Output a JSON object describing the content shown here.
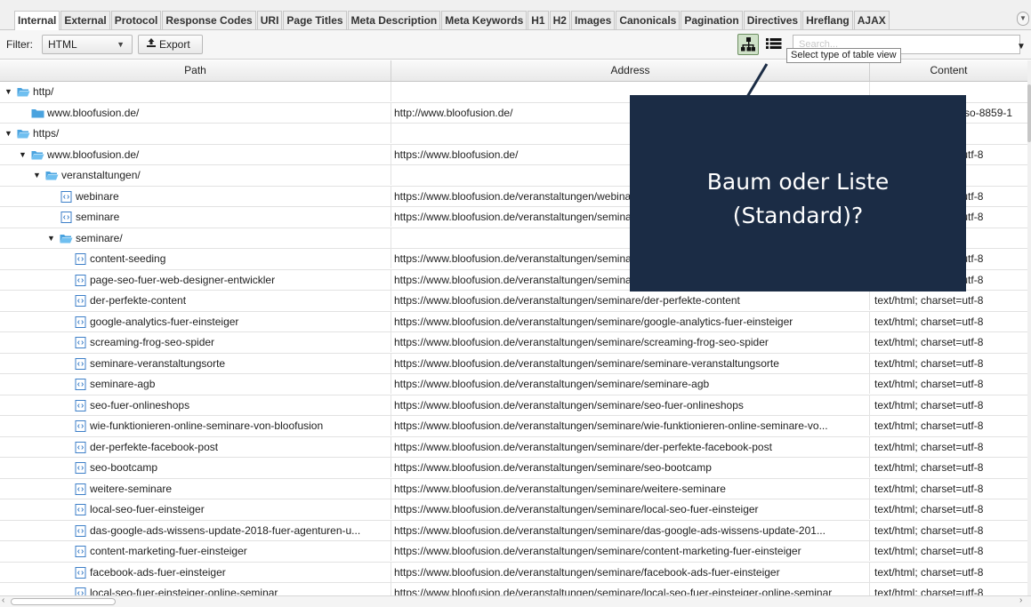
{
  "tabs": [
    "Internal",
    "External",
    "Protocol",
    "Response Codes",
    "URI",
    "Page Titles",
    "Meta Description",
    "Meta Keywords",
    "H1",
    "H2",
    "Images",
    "Canonicals",
    "Pagination",
    "Directives",
    "Hreflang",
    "AJAX"
  ],
  "active_tab": "Internal",
  "toolbar": {
    "filter_label": "Filter:",
    "filter_value": "HTML",
    "export_label": "Export",
    "search_placeholder": "Search...",
    "tooltip": "Select type of table view"
  },
  "columns": {
    "path": "Path",
    "address": "Address",
    "content": "Content"
  },
  "rows": [
    {
      "path": "http/",
      "level": 0,
      "type": "folder-open",
      "arrow": true,
      "address": "",
      "content": ""
    },
    {
      "path": "www.bloofusion.de/",
      "level": 1,
      "type": "folder",
      "arrow": false,
      "address": "http://www.bloofusion.de/",
      "content": "text/html; charset=iso-8859-1"
    },
    {
      "path": "https/",
      "level": 0,
      "type": "folder-open",
      "arrow": true,
      "address": "",
      "content": ""
    },
    {
      "path": "www.bloofusion.de/",
      "level": 1,
      "type": "folder-open",
      "arrow": true,
      "address": "https://www.bloofusion.de/",
      "content": "text/html; charset=utf-8"
    },
    {
      "path": "veranstaltungen/",
      "level": 2,
      "type": "folder-open",
      "arrow": true,
      "address": "",
      "content": ""
    },
    {
      "path": "webinare",
      "level": 3,
      "type": "file",
      "arrow": false,
      "address": "https://www.bloofusion.de/veranstaltungen/webinare",
      "content": "text/html; charset=utf-8"
    },
    {
      "path": "seminare",
      "level": 3,
      "type": "file",
      "arrow": false,
      "address": "https://www.bloofusion.de/veranstaltungen/seminare",
      "content": "text/html; charset=utf-8"
    },
    {
      "path": "seminare/",
      "level": 3,
      "type": "folder-open",
      "arrow": true,
      "address": "",
      "content": ""
    },
    {
      "path": "content-seeding",
      "level": 4,
      "type": "file",
      "arrow": false,
      "address": "https://www.bloofusion.de/veranstaltungen/seminare/content-seeding",
      "content": "text/html; charset=utf-8"
    },
    {
      "path": "page-seo-fuer-web-designer-entwickler",
      "level": 4,
      "type": "file",
      "arrow": false,
      "address": "https://www.bloofusion.de/veranstaltungen/seminare/page-seo-fuer-web-designer-entwickler",
      "content": "text/html; charset=utf-8"
    },
    {
      "path": "der-perfekte-content",
      "level": 4,
      "type": "file",
      "arrow": false,
      "address": "https://www.bloofusion.de/veranstaltungen/seminare/der-perfekte-content",
      "content": "text/html; charset=utf-8"
    },
    {
      "path": "google-analytics-fuer-einsteiger",
      "level": 4,
      "type": "file",
      "arrow": false,
      "address": "https://www.bloofusion.de/veranstaltungen/seminare/google-analytics-fuer-einsteiger",
      "content": "text/html; charset=utf-8"
    },
    {
      "path": "screaming-frog-seo-spider",
      "level": 4,
      "type": "file",
      "arrow": false,
      "address": "https://www.bloofusion.de/veranstaltungen/seminare/screaming-frog-seo-spider",
      "content": "text/html; charset=utf-8"
    },
    {
      "path": "seminare-veranstaltungsorte",
      "level": 4,
      "type": "file",
      "arrow": false,
      "address": "https://www.bloofusion.de/veranstaltungen/seminare/seminare-veranstaltungsorte",
      "content": "text/html; charset=utf-8"
    },
    {
      "path": "seminare-agb",
      "level": 4,
      "type": "file",
      "arrow": false,
      "address": "https://www.bloofusion.de/veranstaltungen/seminare/seminare-agb",
      "content": "text/html; charset=utf-8"
    },
    {
      "path": "seo-fuer-onlineshops",
      "level": 4,
      "type": "file",
      "arrow": false,
      "address": "https://www.bloofusion.de/veranstaltungen/seminare/seo-fuer-onlineshops",
      "content": "text/html; charset=utf-8"
    },
    {
      "path": "wie-funktionieren-online-seminare-von-bloofusion",
      "level": 4,
      "type": "file",
      "arrow": false,
      "address": "https://www.bloofusion.de/veranstaltungen/seminare/wie-funktionieren-online-seminare-vo...",
      "content": "text/html; charset=utf-8"
    },
    {
      "path": "der-perfekte-facebook-post",
      "level": 4,
      "type": "file",
      "arrow": false,
      "address": "https://www.bloofusion.de/veranstaltungen/seminare/der-perfekte-facebook-post",
      "content": "text/html; charset=utf-8"
    },
    {
      "path": "seo-bootcamp",
      "level": 4,
      "type": "file",
      "arrow": false,
      "address": "https://www.bloofusion.de/veranstaltungen/seminare/seo-bootcamp",
      "content": "text/html; charset=utf-8"
    },
    {
      "path": "weitere-seminare",
      "level": 4,
      "type": "file",
      "arrow": false,
      "address": "https://www.bloofusion.de/veranstaltungen/seminare/weitere-seminare",
      "content": "text/html; charset=utf-8"
    },
    {
      "path": "local-seo-fuer-einsteiger",
      "level": 4,
      "type": "file",
      "arrow": false,
      "address": "https://www.bloofusion.de/veranstaltungen/seminare/local-seo-fuer-einsteiger",
      "content": "text/html; charset=utf-8"
    },
    {
      "path": "das-google-ads-wissens-update-2018-fuer-agenturen-u...",
      "level": 4,
      "type": "file",
      "arrow": false,
      "address": "https://www.bloofusion.de/veranstaltungen/seminare/das-google-ads-wissens-update-201...",
      "content": "text/html; charset=utf-8"
    },
    {
      "path": "content-marketing-fuer-einsteiger",
      "level": 4,
      "type": "file",
      "arrow": false,
      "address": "https://www.bloofusion.de/veranstaltungen/seminare/content-marketing-fuer-einsteiger",
      "content": "text/html; charset=utf-8"
    },
    {
      "path": "facebook-ads-fuer-einsteiger",
      "level": 4,
      "type": "file",
      "arrow": false,
      "address": "https://www.bloofusion.de/veranstaltungen/seminare/facebook-ads-fuer-einsteiger",
      "content": "text/html; charset=utf-8"
    },
    {
      "path": "local-seo-fuer-einsteiger-online-seminar",
      "level": 4,
      "type": "file",
      "arrow": false,
      "address": "https://www.bloofusion.de/veranstaltungen/seminare/local-seo-fuer-einsteiger-online-seminar",
      "content": "text/html; charset=utf-8"
    }
  ],
  "callout": {
    "line1": "Baum oder Liste",
    "line2": "(Standard)?"
  },
  "colors": {
    "callout_bg": "#1b2c45",
    "folder": "#4aa3df",
    "file_icon": "#3d7fc8",
    "tree_button_bg": "#cfe1c8"
  },
  "icons": {
    "tree": "tree-view-icon",
    "list": "list-view-icon",
    "export": "export-upload-icon",
    "folder": "folder-icon",
    "file": "html-file-icon"
  }
}
